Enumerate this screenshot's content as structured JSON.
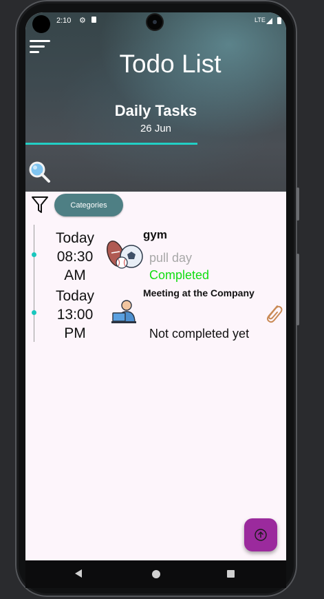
{
  "status_bar": {
    "time": "2:10",
    "icons": [
      "settings-icon",
      "sd-card-icon"
    ],
    "network": "LTE",
    "signal_icon": "signal-icon",
    "battery_icon": "battery-icon"
  },
  "header": {
    "menu_icon": "menu-icon",
    "app_title": "Todo List",
    "section_title": "Daily Tasks",
    "date": "26 Jun",
    "progress_fraction": 0.66,
    "progress_color": "#22cfc5",
    "search_icon": "search-icon"
  },
  "toolbar": {
    "filter_icon": "filter-icon",
    "categories_label": "Categories",
    "categories_color": "#4e7f84"
  },
  "tasks": [
    {
      "day": "Today",
      "time": "08:30",
      "period": "AM",
      "icon": "sports-icon",
      "title": "gym",
      "description": "pull day",
      "status": "Completed",
      "status_color": "#11dd11"
    },
    {
      "day": "Today",
      "time": "13:00",
      "period": "PM",
      "icon": "office-worker-icon",
      "title": "Meeting at the Company",
      "description": "",
      "status": "Not completed yet",
      "status_color": "#111111",
      "attachment_icon": "paperclip-icon"
    }
  ],
  "fab": {
    "icon": "upload-icon",
    "color": "#9b2a9d"
  },
  "nav_bar": {
    "back_icon": "back-icon",
    "home_icon": "home-icon",
    "recents_icon": "recents-icon"
  }
}
